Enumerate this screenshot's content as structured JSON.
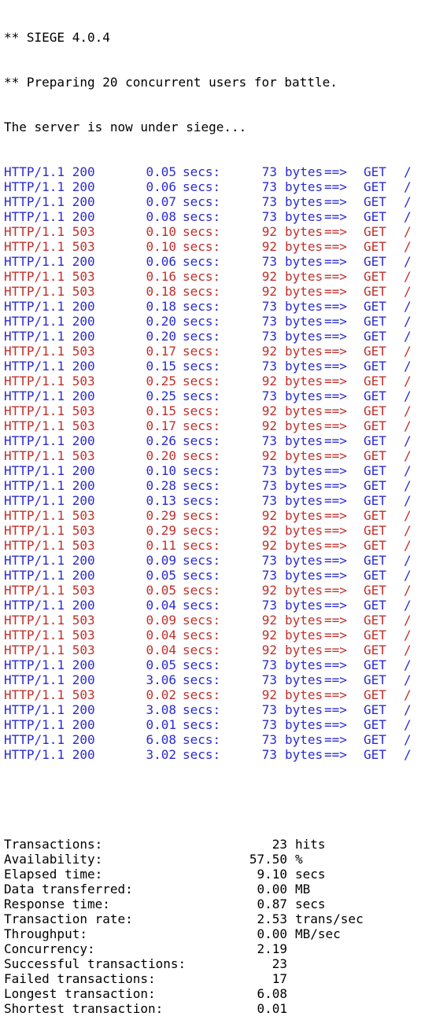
{
  "header": {
    "version_line": "** SIEGE 4.0.4",
    "preparing_line": "** Preparing 20 concurrent users for battle.",
    "siege_line": "The server is now under siege..."
  },
  "colors": {
    "success": "#2b2bd1",
    "error": "#c0302c",
    "text": "#000000",
    "background": "#ffffff"
  },
  "requests": [
    {
      "status": "HTTP/1.1 200",
      "time": "0.05",
      "unit": "secs:",
      "bytes": "73",
      "bytes_label": "bytes",
      "arrow": "==>",
      "method": "GET",
      "path": "/",
      "kind": "ok"
    },
    {
      "status": "HTTP/1.1 200",
      "time": "0.06",
      "unit": "secs:",
      "bytes": "73",
      "bytes_label": "bytes",
      "arrow": "==>",
      "method": "GET",
      "path": "/",
      "kind": "ok"
    },
    {
      "status": "HTTP/1.1 200",
      "time": "0.07",
      "unit": "secs:",
      "bytes": "73",
      "bytes_label": "bytes",
      "arrow": "==>",
      "method": "GET",
      "path": "/",
      "kind": "ok"
    },
    {
      "status": "HTTP/1.1 200",
      "time": "0.08",
      "unit": "secs:",
      "bytes": "73",
      "bytes_label": "bytes",
      "arrow": "==>",
      "method": "GET",
      "path": "/",
      "kind": "ok"
    },
    {
      "status": "HTTP/1.1 503",
      "time": "0.10",
      "unit": "secs:",
      "bytes": "92",
      "bytes_label": "bytes",
      "arrow": "==>",
      "method": "GET",
      "path": "/",
      "kind": "err"
    },
    {
      "status": "HTTP/1.1 503",
      "time": "0.10",
      "unit": "secs:",
      "bytes": "92",
      "bytes_label": "bytes",
      "arrow": "==>",
      "method": "GET",
      "path": "/",
      "kind": "err"
    },
    {
      "status": "HTTP/1.1 200",
      "time": "0.06",
      "unit": "secs:",
      "bytes": "73",
      "bytes_label": "bytes",
      "arrow": "==>",
      "method": "GET",
      "path": "/",
      "kind": "ok"
    },
    {
      "status": "HTTP/1.1 503",
      "time": "0.16",
      "unit": "secs:",
      "bytes": "92",
      "bytes_label": "bytes",
      "arrow": "==>",
      "method": "GET",
      "path": "/",
      "kind": "err"
    },
    {
      "status": "HTTP/1.1 503",
      "time": "0.18",
      "unit": "secs:",
      "bytes": "92",
      "bytes_label": "bytes",
      "arrow": "==>",
      "method": "GET",
      "path": "/",
      "kind": "err"
    },
    {
      "status": "HTTP/1.1 200",
      "time": "0.18",
      "unit": "secs:",
      "bytes": "73",
      "bytes_label": "bytes",
      "arrow": "==>",
      "method": "GET",
      "path": "/",
      "kind": "ok"
    },
    {
      "status": "HTTP/1.1 200",
      "time": "0.20",
      "unit": "secs:",
      "bytes": "73",
      "bytes_label": "bytes",
      "arrow": "==>",
      "method": "GET",
      "path": "/",
      "kind": "ok"
    },
    {
      "status": "HTTP/1.1 200",
      "time": "0.20",
      "unit": "secs:",
      "bytes": "73",
      "bytes_label": "bytes",
      "arrow": "==>",
      "method": "GET",
      "path": "/",
      "kind": "ok"
    },
    {
      "status": "HTTP/1.1 503",
      "time": "0.17",
      "unit": "secs:",
      "bytes": "92",
      "bytes_label": "bytes",
      "arrow": "==>",
      "method": "GET",
      "path": "/",
      "kind": "err"
    },
    {
      "status": "HTTP/1.1 200",
      "time": "0.15",
      "unit": "secs:",
      "bytes": "73",
      "bytes_label": "bytes",
      "arrow": "==>",
      "method": "GET",
      "path": "/",
      "kind": "ok"
    },
    {
      "status": "HTTP/1.1 503",
      "time": "0.25",
      "unit": "secs:",
      "bytes": "92",
      "bytes_label": "bytes",
      "arrow": "==>",
      "method": "GET",
      "path": "/",
      "kind": "err"
    },
    {
      "status": "HTTP/1.1 200",
      "time": "0.25",
      "unit": "secs:",
      "bytes": "73",
      "bytes_label": "bytes",
      "arrow": "==>",
      "method": "GET",
      "path": "/",
      "kind": "ok"
    },
    {
      "status": "HTTP/1.1 503",
      "time": "0.15",
      "unit": "secs:",
      "bytes": "92",
      "bytes_label": "bytes",
      "arrow": "==>",
      "method": "GET",
      "path": "/",
      "kind": "err"
    },
    {
      "status": "HTTP/1.1 503",
      "time": "0.17",
      "unit": "secs:",
      "bytes": "92",
      "bytes_label": "bytes",
      "arrow": "==>",
      "method": "GET",
      "path": "/",
      "kind": "err"
    },
    {
      "status": "HTTP/1.1 200",
      "time": "0.26",
      "unit": "secs:",
      "bytes": "73",
      "bytes_label": "bytes",
      "arrow": "==>",
      "method": "GET",
      "path": "/",
      "kind": "ok"
    },
    {
      "status": "HTTP/1.1 503",
      "time": "0.20",
      "unit": "secs:",
      "bytes": "92",
      "bytes_label": "bytes",
      "arrow": "==>",
      "method": "GET",
      "path": "/",
      "kind": "err"
    },
    {
      "status": "HTTP/1.1 200",
      "time": "0.10",
      "unit": "secs:",
      "bytes": "73",
      "bytes_label": "bytes",
      "arrow": "==>",
      "method": "GET",
      "path": "/",
      "kind": "ok"
    },
    {
      "status": "HTTP/1.1 200",
      "time": "0.28",
      "unit": "secs:",
      "bytes": "73",
      "bytes_label": "bytes",
      "arrow": "==>",
      "method": "GET",
      "path": "/",
      "kind": "ok"
    },
    {
      "status": "HTTP/1.1 200",
      "time": "0.13",
      "unit": "secs:",
      "bytes": "73",
      "bytes_label": "bytes",
      "arrow": "==>",
      "method": "GET",
      "path": "/",
      "kind": "ok"
    },
    {
      "status": "HTTP/1.1 503",
      "time": "0.29",
      "unit": "secs:",
      "bytes": "92",
      "bytes_label": "bytes",
      "arrow": "==>",
      "method": "GET",
      "path": "/",
      "kind": "err"
    },
    {
      "status": "HTTP/1.1 503",
      "time": "0.29",
      "unit": "secs:",
      "bytes": "92",
      "bytes_label": "bytes",
      "arrow": "==>",
      "method": "GET",
      "path": "/",
      "kind": "err"
    },
    {
      "status": "HTTP/1.1 503",
      "time": "0.11",
      "unit": "secs:",
      "bytes": "92",
      "bytes_label": "bytes",
      "arrow": "==>",
      "method": "GET",
      "path": "/",
      "kind": "err"
    },
    {
      "status": "HTTP/1.1 200",
      "time": "0.09",
      "unit": "secs:",
      "bytes": "73",
      "bytes_label": "bytes",
      "arrow": "==>",
      "method": "GET",
      "path": "/",
      "kind": "ok"
    },
    {
      "status": "HTTP/1.1 200",
      "time": "0.05",
      "unit": "secs:",
      "bytes": "73",
      "bytes_label": "bytes",
      "arrow": "==>",
      "method": "GET",
      "path": "/",
      "kind": "ok"
    },
    {
      "status": "HTTP/1.1 503",
      "time": "0.05",
      "unit": "secs:",
      "bytes": "92",
      "bytes_label": "bytes",
      "arrow": "==>",
      "method": "GET",
      "path": "/",
      "kind": "err"
    },
    {
      "status": "HTTP/1.1 200",
      "time": "0.04",
      "unit": "secs:",
      "bytes": "73",
      "bytes_label": "bytes",
      "arrow": "==>",
      "method": "GET",
      "path": "/",
      "kind": "ok"
    },
    {
      "status": "HTTP/1.1 503",
      "time": "0.09",
      "unit": "secs:",
      "bytes": "92",
      "bytes_label": "bytes",
      "arrow": "==>",
      "method": "GET",
      "path": "/",
      "kind": "err"
    },
    {
      "status": "HTTP/1.1 503",
      "time": "0.04",
      "unit": "secs:",
      "bytes": "92",
      "bytes_label": "bytes",
      "arrow": "==>",
      "method": "GET",
      "path": "/",
      "kind": "err"
    },
    {
      "status": "HTTP/1.1 503",
      "time": "0.04",
      "unit": "secs:",
      "bytes": "92",
      "bytes_label": "bytes",
      "arrow": "==>",
      "method": "GET",
      "path": "/",
      "kind": "err"
    },
    {
      "status": "HTTP/1.1 200",
      "time": "0.05",
      "unit": "secs:",
      "bytes": "73",
      "bytes_label": "bytes",
      "arrow": "==>",
      "method": "GET",
      "path": "/",
      "kind": "ok"
    },
    {
      "status": "HTTP/1.1 200",
      "time": "3.06",
      "unit": "secs:",
      "bytes": "73",
      "bytes_label": "bytes",
      "arrow": "==>",
      "method": "GET",
      "path": "/",
      "kind": "ok"
    },
    {
      "status": "HTTP/1.1 503",
      "time": "0.02",
      "unit": "secs:",
      "bytes": "92",
      "bytes_label": "bytes",
      "arrow": "==>",
      "method": "GET",
      "path": "/",
      "kind": "err"
    },
    {
      "status": "HTTP/1.1 200",
      "time": "3.08",
      "unit": "secs:",
      "bytes": "73",
      "bytes_label": "bytes",
      "arrow": "==>",
      "method": "GET",
      "path": "/",
      "kind": "ok"
    },
    {
      "status": "HTTP/1.1 200",
      "time": "0.01",
      "unit": "secs:",
      "bytes": "73",
      "bytes_label": "bytes",
      "arrow": "==>",
      "method": "GET",
      "path": "/",
      "kind": "ok"
    },
    {
      "status": "HTTP/1.1 200",
      "time": "6.08",
      "unit": "secs:",
      "bytes": "73",
      "bytes_label": "bytes",
      "arrow": "==>",
      "method": "GET",
      "path": "/",
      "kind": "ok"
    },
    {
      "status": "HTTP/1.1 200",
      "time": "3.02",
      "unit": "secs:",
      "bytes": "73",
      "bytes_label": "bytes",
      "arrow": "==>",
      "method": "GET",
      "path": "/",
      "kind": "ok"
    }
  ],
  "summary": [
    {
      "label": "Transactions:",
      "value": "23",
      "unit": "hits"
    },
    {
      "label": "Availability:",
      "value": "57.50",
      "unit": "%"
    },
    {
      "label": "Elapsed time:",
      "value": "9.10",
      "unit": "secs"
    },
    {
      "label": "Data transferred:",
      "value": "0.00",
      "unit": "MB"
    },
    {
      "label": "Response time:",
      "value": "0.87",
      "unit": "secs"
    },
    {
      "label": "Transaction rate:",
      "value": "2.53",
      "unit": "trans/sec"
    },
    {
      "label": "Throughput:",
      "value": "0.00",
      "unit": "MB/sec"
    },
    {
      "label": "Concurrency:",
      "value": "2.19",
      "unit": ""
    },
    {
      "label": "Successful transactions:",
      "value": "23",
      "unit": ""
    },
    {
      "label": "Failed transactions:",
      "value": "17",
      "unit": ""
    },
    {
      "label": "Longest transaction:",
      "value": "6.08",
      "unit": ""
    },
    {
      "label": "Shortest transaction:",
      "value": "0.01",
      "unit": ""
    }
  ]
}
